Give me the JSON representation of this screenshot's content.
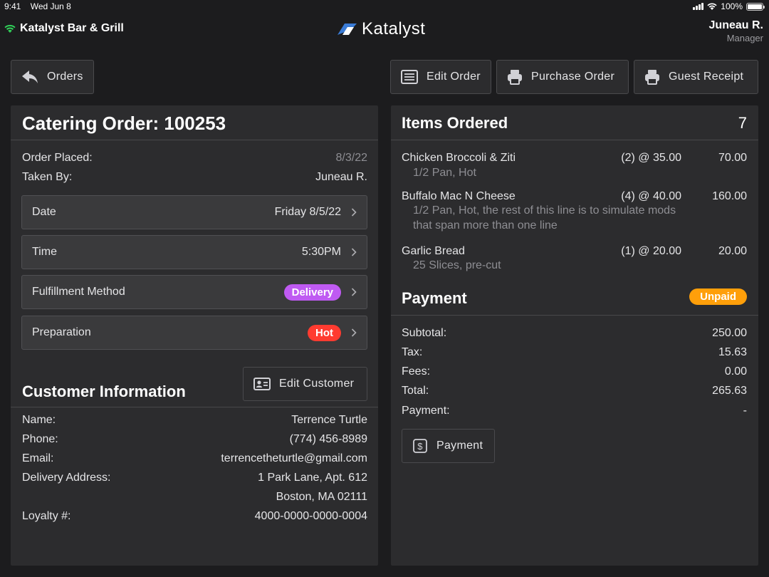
{
  "status_bar": {
    "time": "9:41",
    "date": "Wed Jun 8",
    "battery": "100%"
  },
  "header": {
    "venue_name": "Katalyst Bar & Grill",
    "logo_text": "Katalyst",
    "user_name": "Juneau R.",
    "user_role": "Manager"
  },
  "toolbar": {
    "orders_label": "Orders",
    "edit_order_label": "Edit Order",
    "purchase_order_label": "Purchase Order",
    "guest_receipt_label": "Guest Receipt"
  },
  "order": {
    "title": "Catering Order: 100253",
    "order_placed_label": "Order Placed:",
    "order_placed_value": "8/3/22",
    "taken_by_label": "Taken By:",
    "taken_by_value": "Juneau R.",
    "fields": [
      {
        "label": "Date",
        "value": "Friday 8/5/22"
      },
      {
        "label": "Time",
        "value": "5:30PM"
      },
      {
        "label": "Fulfillment Method",
        "value": "Delivery",
        "badge_color": "#bf5af2"
      },
      {
        "label": "Preparation",
        "value": "Hot",
        "badge_color": "#ff3b30"
      }
    ]
  },
  "customer": {
    "title": "Customer Information",
    "edit_label": "Edit Customer",
    "name_label": "Name:",
    "name_value": "Terrence Turtle",
    "phone_label": "Phone:",
    "phone_value": "(774) 456-8989",
    "email_label": "Email:",
    "email_value": "terrencetheturtle@gmail.com",
    "address_label": "Delivery Address:",
    "address_line1": "1 Park Lane, Apt. 612",
    "address_line2": "Boston, MA 02111",
    "loyalty_label": "Loyalty #:",
    "loyalty_value": "4000-0000-0000-0004"
  },
  "items": {
    "title": "Items Ordered",
    "count": "7",
    "list": [
      {
        "name": "Chicken Broccoli & Ziti",
        "qty": "(2) @ 35.00",
        "price": "70.00",
        "mods": "1/2 Pan, Hot"
      },
      {
        "name": "Buffalo Mac N Cheese",
        "qty": "(4) @ 40.00",
        "price": "160.00",
        "mods": "1/2 Pan, Hot, the rest of this line is to simulate mods that span more than one line"
      },
      {
        "name": "Garlic Bread",
        "qty": "(1) @ 20.00",
        "price": "20.00",
        "mods": "25 Slices, pre-cut"
      }
    ]
  },
  "payment": {
    "title": "Payment",
    "status": "Unpaid",
    "status_color": "#ff9f0a",
    "subtotal_label": "Subtotal:",
    "subtotal_value": "250.00",
    "tax_label": "Tax:",
    "tax_value": "15.63",
    "fees_label": "Fees:",
    "fees_value": "0.00",
    "total_label": "Total:",
    "total_value": "265.63",
    "payment_label": "Payment:",
    "payment_value": "-",
    "button_label": "Payment"
  }
}
